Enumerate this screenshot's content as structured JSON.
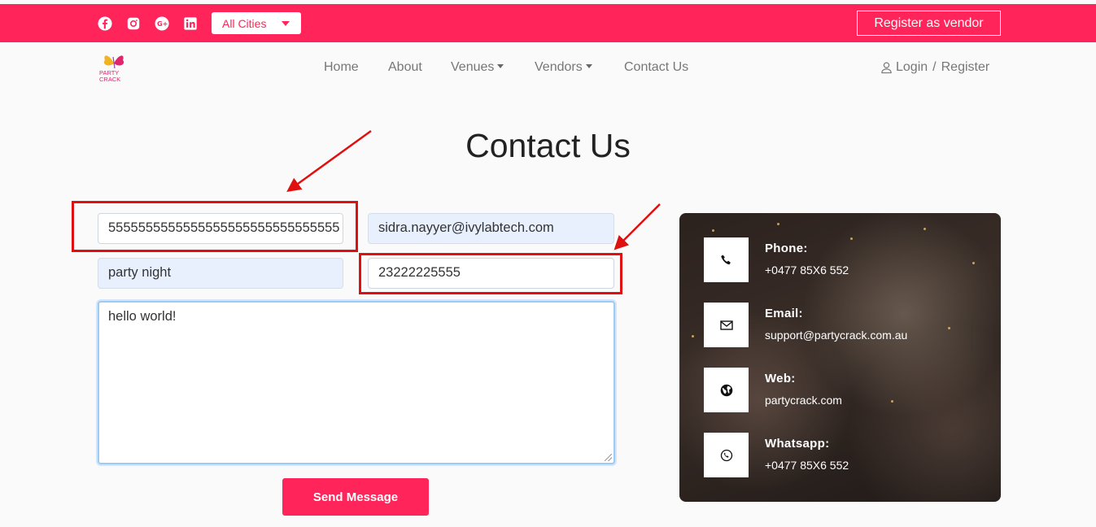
{
  "topbar": {
    "city_select": "All Cities",
    "vendor_button": "Register as vendor",
    "social_icons": [
      "facebook-icon",
      "instagram-icon",
      "google-plus-icon",
      "linkedin-icon"
    ]
  },
  "brand": {
    "logo_text_line1": "PARTY",
    "logo_text_line2": "CRACK"
  },
  "nav": {
    "items": [
      {
        "label": "Home",
        "has_caret": false
      },
      {
        "label": "About",
        "has_caret": false
      },
      {
        "label": "Venues",
        "has_caret": true
      },
      {
        "label": "Vendors",
        "has_caret": true
      },
      {
        "label": "Contact Us",
        "has_caret": false
      }
    ],
    "login": "Login",
    "separator": "/",
    "register": "Register"
  },
  "page": {
    "title": "Contact Us"
  },
  "form": {
    "name_value": "5555555555555555555555555555555",
    "email_value": "sidra.nayyer@ivylabtech.com",
    "subject_value": "party night",
    "phone_value": "23222225555",
    "message_value": "hello world!",
    "submit_label": "Send Message"
  },
  "contact_info": {
    "items": [
      {
        "label": "Phone:",
        "value": "+0477 85X6 552",
        "icon": "phone-icon"
      },
      {
        "label": "Email:",
        "value": "support@partycrack.com.au",
        "icon": "mail-icon"
      },
      {
        "label": "Web:",
        "value": "partycrack.com",
        "icon": "globe-icon"
      },
      {
        "label": "Whatsapp:",
        "value": "+0477 85X6 552",
        "icon": "whatsapp-icon"
      }
    ]
  },
  "colors": {
    "brand": "#ff2459",
    "annotation": "#e01010"
  }
}
